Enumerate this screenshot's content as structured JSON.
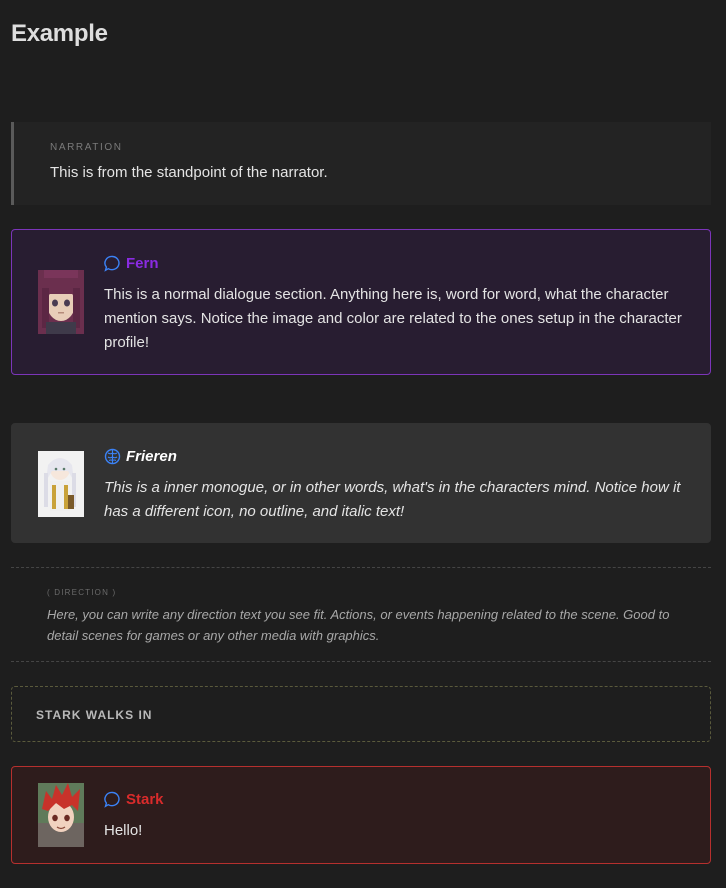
{
  "page": {
    "title": "Example"
  },
  "narration": {
    "label": "NARRATION",
    "text": "This is from the standpoint of the narrator."
  },
  "dialogues": [
    {
      "speaker": "Fern",
      "speaker_color": "#8a2be2",
      "icon": "speech-bubble-icon",
      "icon_color": "#3b82f6",
      "text": "This is a normal dialogue section. Anything here is, word for word, what the character mention says. Notice the image and color are related to the ones setup in the character profile!",
      "style": "normal",
      "border_color": "#7c35b9"
    },
    {
      "speaker": "Frieren",
      "speaker_color": "#ffffff",
      "icon": "brain-icon",
      "icon_color": "#3b82f6",
      "text": "This is a inner monogue, or in other words, what's in the characters mind. Notice how it has a different icon, no outline, and italic text!",
      "style": "italic"
    },
    {
      "speaker": "Stark",
      "speaker_color": "#d92b2b",
      "icon": "speech-bubble-icon",
      "icon_color": "#3b82f6",
      "text": "Hello!",
      "style": "normal",
      "border_color": "#b6302e"
    }
  ],
  "direction": {
    "label": "( DIRECTION )",
    "text": "Here, you can write any direction text you see fit. Actions, or events happening related to the scene. Good to detail scenes for games or any other media with graphics."
  },
  "scene_event": {
    "text": "STARK WALKS IN"
  }
}
